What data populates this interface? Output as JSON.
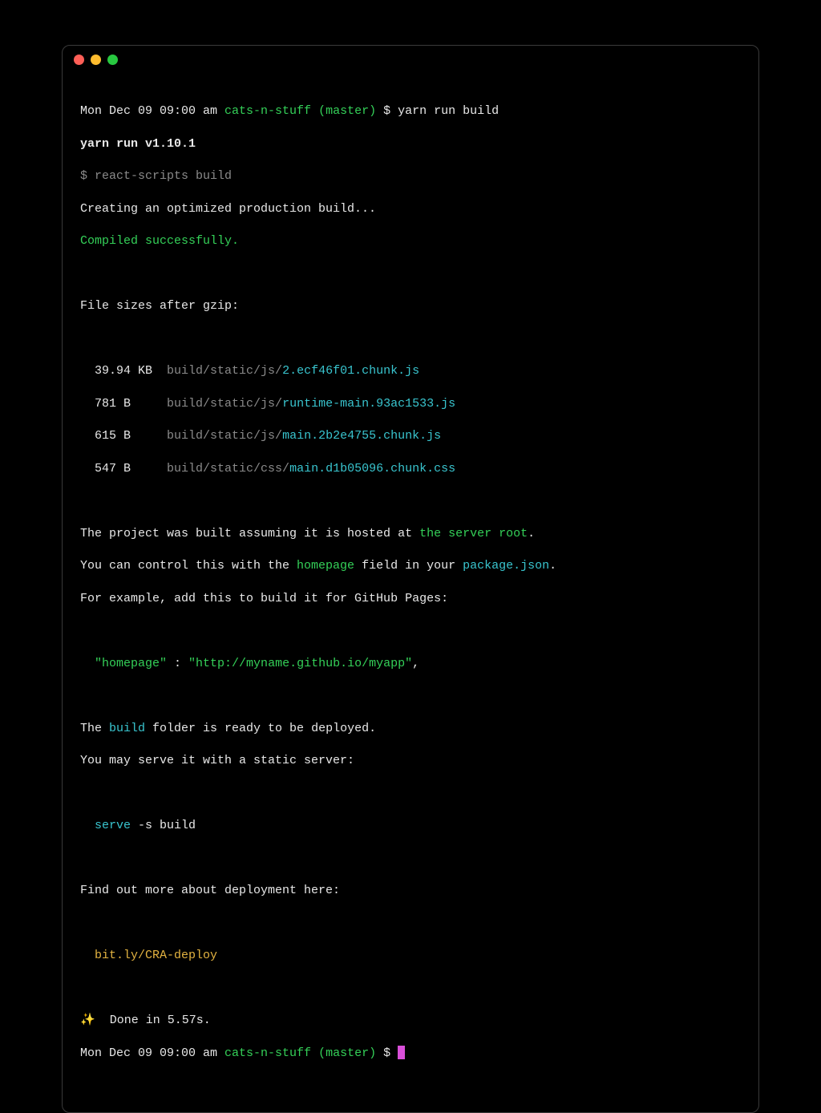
{
  "titlebar": {
    "close": "close",
    "minimize": "minimize",
    "maximize": "maximize"
  },
  "prompt1": {
    "datetime": "Mon Dec 09 09:00 am ",
    "repo": "cats-n-stuff",
    "branch": " (master)",
    "sep": " $ ",
    "command": "yarn run build"
  },
  "yarn_version": "yarn run v1.10.1",
  "script_cmd": "$ react-scripts build",
  "creating": "Creating an optimized production build...",
  "compiled": "Compiled successfully.",
  "sizes_header": "File sizes after gzip:",
  "indent": "  ",
  "files": [
    {
      "size": "39.94 KB",
      "path": "build/static/js/",
      "name": "2.ecf46f01.chunk.js"
    },
    {
      "size": "781 B",
      "path": "build/static/js/",
      "name": "runtime-main.93ac1533.js"
    },
    {
      "size": "615 B",
      "path": "build/static/js/",
      "name": "main.2b2e4755.chunk.js"
    },
    {
      "size": "547 B",
      "path": "build/static/css/",
      "name": "main.d1b05096.chunk.css"
    }
  ],
  "hosted1_a": "The project was built assuming it is hosted at ",
  "hosted1_b": "the server root",
  "hosted1_c": ".",
  "hosted2_a": "You can control this with the ",
  "hosted2_b": "homepage",
  "hosted2_c": " field in your ",
  "hosted2_d": "package.json",
  "hosted2_e": ".",
  "hosted3": "For example, add this to build it for GitHub Pages:",
  "homepage_key": "\"homepage\"",
  "homepage_colon": " : ",
  "homepage_val": "\"http://myname.github.io/myapp\"",
  "homepage_comma": ",",
  "deploy1_a": "The ",
  "deploy1_b": "build",
  "deploy1_c": " folder is ready to be deployed.",
  "deploy2": "You may serve it with a static server:",
  "serve_cmd_a": "serve",
  "serve_cmd_b": " -s build",
  "findout": "Find out more about deployment here:",
  "deploy_link": "bit.ly/CRA-deploy",
  "sparkle": "✨",
  "done": "  Done in 5.57s.",
  "prompt2": {
    "datetime": "Mon Dec 09 09:00 am ",
    "repo": "cats-n-stuff",
    "branch": " (master)",
    "sep": " $ "
  }
}
